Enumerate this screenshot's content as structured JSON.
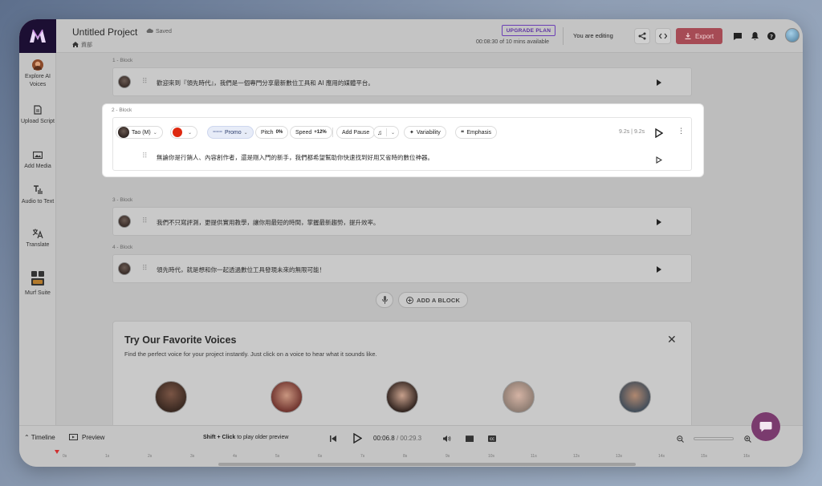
{
  "project": {
    "title": "Untitled Project",
    "saved": "Saved",
    "breadcrumb": "資部"
  },
  "header": {
    "upgrade": "UPGRADE PLAN",
    "minutes": "00:08:30 of 10 mins available",
    "editing": "You are editing",
    "export": "Export"
  },
  "sidebar": {
    "items": [
      {
        "label": "Explore AI Voices",
        "icon": "avatar-icon"
      },
      {
        "label": "Upload Script",
        "icon": "upload-script-icon"
      },
      {
        "label": "Add Media",
        "icon": "media-icon"
      },
      {
        "label": "Audio to Text",
        "icon": "audio-to-text-icon"
      },
      {
        "label": "Translate",
        "icon": "translate-icon"
      },
      {
        "label": "Murf Suite",
        "icon": "suite-icon"
      }
    ]
  },
  "blocks": [
    {
      "label": "1 - Block",
      "text": "歡迎來到『領先時代』，我們是一個專門分享最新數位工具和 AI 應用的媒體平台。"
    },
    {
      "label": "2 - Block",
      "text": "無論你是行銷人、內容創作者，還是剛入門的新手，我們都希望幫助你快速找到好用又省時的數位神器。"
    },
    {
      "label": "3 - Block",
      "text": "我們不只寫評測，更提供實用教學，讓你用最短的時間，掌握最新趨勢，提升效率。"
    },
    {
      "label": "4 - Block",
      "text": "領先時代，就是想和你一起透過數位工具發現未來的無限可能！"
    }
  ],
  "block_controls": {
    "voice": "Tao (M)",
    "style": "Promo",
    "pitch_label": "Pitch",
    "pitch_value": "0%",
    "speed_label": "Speed",
    "speed_value": "+12%",
    "add_pause": "Add Pause",
    "variability": "Variability",
    "emphasis": "Emphasis",
    "duration": "9.2s | 9.2s"
  },
  "add_block": "ADD A BLOCK",
  "voices_panel": {
    "title": "Try Our Favorite Voices",
    "subtitle": "Find the perfect voice for your project instantly. Just click on a voice to hear what it sounds like."
  },
  "timeline": {
    "timeline_label": "Timeline",
    "preview_label": "Preview",
    "hint_bold": "Shift + Click",
    "hint_rest": "to play older preview",
    "current_time": "00:06.8",
    "separator": "/",
    "total_time": "00:29.3",
    "ruler": [
      "0s",
      "1s",
      "2s",
      "3s",
      "4s",
      "5s",
      "6s",
      "7s",
      "8s",
      "9s",
      "10s",
      "11s",
      "12s",
      "13s",
      "14s",
      "15s",
      "16s"
    ]
  },
  "colors": {
    "accent": "#6b3fb5",
    "export": "#c2185b",
    "flag": "#de2910"
  }
}
